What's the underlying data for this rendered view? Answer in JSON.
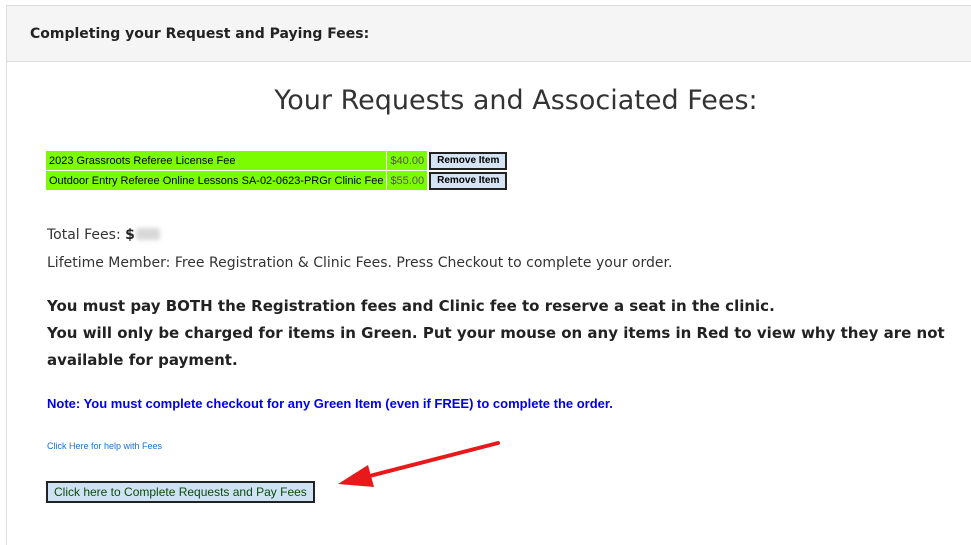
{
  "header": {
    "title": "Completing your Request and Paying Fees:"
  },
  "main": {
    "title": "Your Requests and Associated Fees:",
    "fees": [
      {
        "description": "2023 Grassroots Referee License Fee",
        "amount": "$40.00",
        "action": "Remove Item"
      },
      {
        "description": "Outdoor Entry Referee Online Lessons SA-02-0623-PRGr Clinic Fee",
        "amount": "$55.00",
        "action": "Remove Item"
      }
    ],
    "total_label": "Total Fees:",
    "total_currency": "$",
    "lifetime_text": "Lifetime Member: Free Registration & Clinic Fees. Press Checkout to complete your order.",
    "warnings": [
      "You must pay BOTH the Registration fees and Clinic fee to reserve a seat in the clinic.",
      "You will only be charged for items in Green. Put your mouse on any items in Red to view why they are not available for payment."
    ],
    "note": "Note: You must complete checkout for any Green Item (even if FREE) to complete the order.",
    "help_link": "Click Here for help with Fees",
    "checkout_button": "Click here to Complete Requests and Pay Fees"
  },
  "colors": {
    "fee_row_green": "#7cfc00",
    "note_blue": "#0000ee",
    "arrow_red": "#e8191b",
    "button_bg": "#cfe2f3"
  },
  "annotations": {
    "arrow": "red-arrow-icon"
  }
}
